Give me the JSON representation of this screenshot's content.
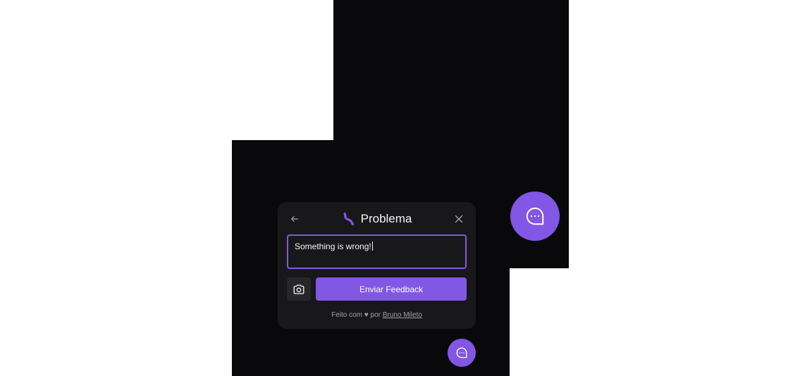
{
  "widget": {
    "title": "Problema",
    "feedback_text": "Something is wrong!",
    "submit_label": "Enviar Feedback",
    "footer": {
      "prefix": "Feito com",
      "heart": "♥",
      "by": "por",
      "author": "Bruno Mileto"
    }
  },
  "icons": {
    "back": "arrow-left-icon",
    "close": "close-icon",
    "type": "worm-icon",
    "screenshot": "camera-icon",
    "fab": "chat-bubble-dots-icon"
  },
  "colors": {
    "accent": "#8257e5",
    "surface": "#18181b",
    "background": "#09090b",
    "text": "#f4f4f5",
    "muted": "#a1a1aa"
  }
}
